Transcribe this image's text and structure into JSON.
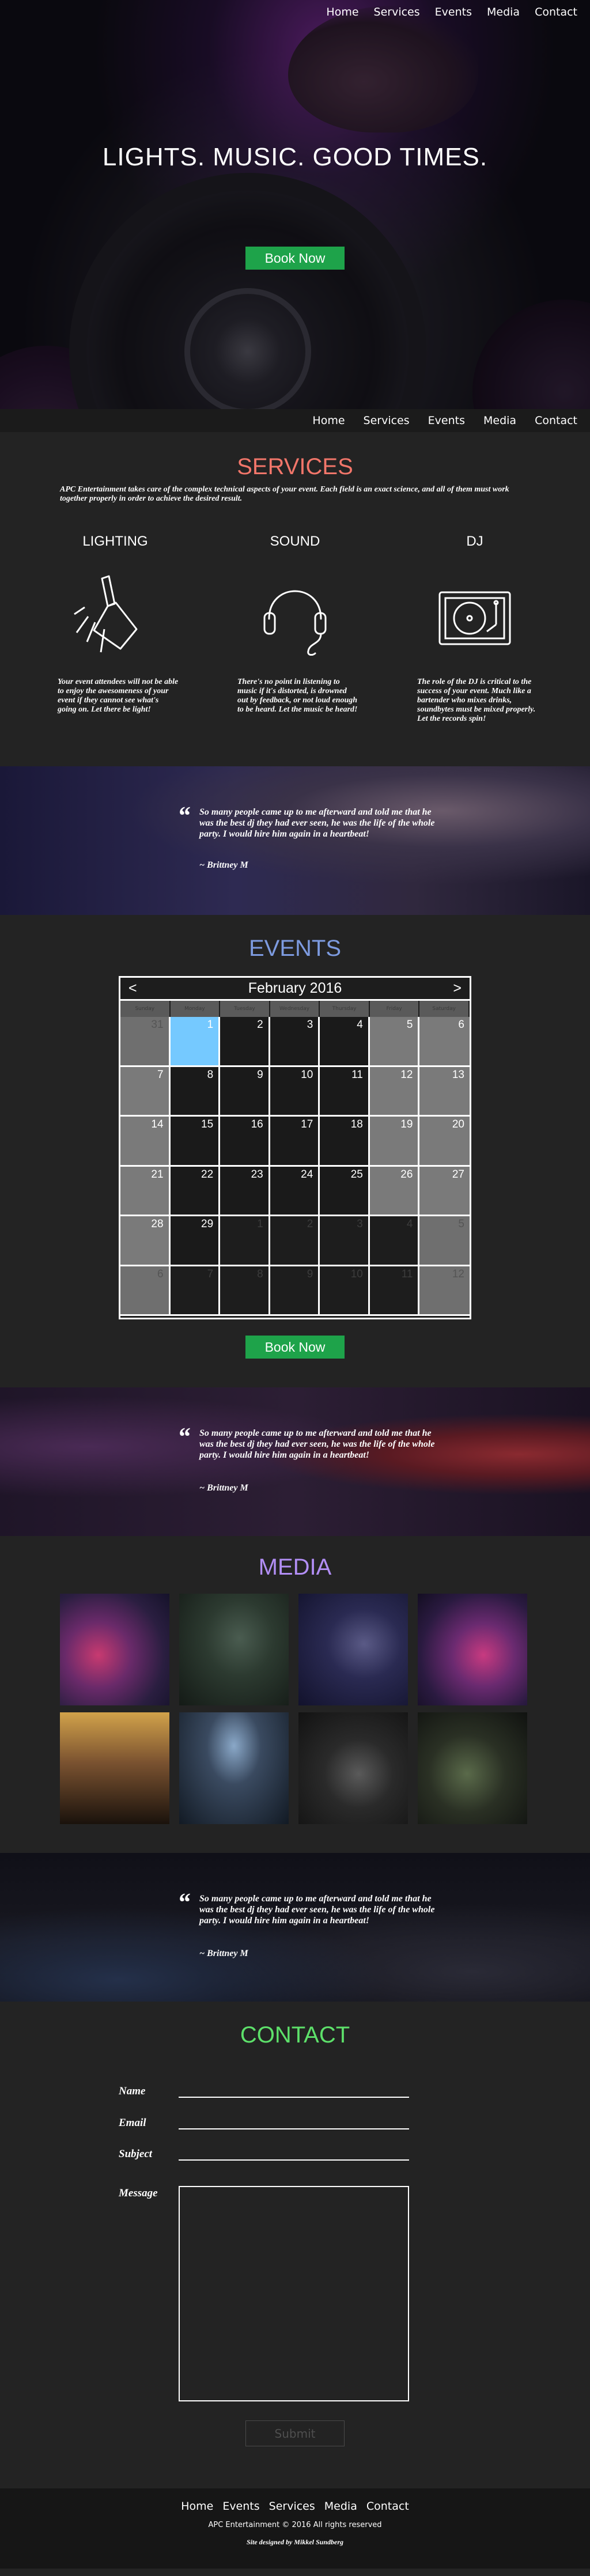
{
  "nav": {
    "items": [
      "Home",
      "Services",
      "Events",
      "Media",
      "Contact"
    ]
  },
  "hero": {
    "headline": "LIGHTS. MUSIC. GOOD TIMES.",
    "cta": "Book Now"
  },
  "services": {
    "title": "SERVICES",
    "intro": "APC Entertainment takes care of the complex technical aspects of your event.  Each field is an exact science, and all of them must work together properly in order to achieve the desired result.",
    "items": [
      {
        "title": "LIGHTING",
        "icon": "spotlight-icon",
        "text": "Your event attendees will not be able to enjoy the awesomeness of your event if they cannot see what's going on.   Let there be light!"
      },
      {
        "title": "SOUND",
        "icon": "headphones-icon",
        "text": "There's no point in listening to music if it's distorted, is drowned out by feedback, or not loud enough to be heard.  Let the music be heard!"
      },
      {
        "title": "DJ",
        "icon": "turntable-icon",
        "text": "The role of the DJ is critical to the success of your event.  Much like a bartender who mixes drinks, soundbytes must be mixed properly.  Let the records spin!"
      }
    ],
    "title_color": "#f2766a"
  },
  "testimonial": {
    "text": "So many people came up to me afterward and told me that he was the best dj they had ever seen, he was the life of the whole party.  I would hire him again in a heartbeat!",
    "author": "~ Brittney M"
  },
  "events": {
    "title": "EVENTS",
    "title_color": "#7d9be0",
    "month": "February 2016",
    "prev": "<",
    "next": ">",
    "weekdays": [
      "Sunday",
      "Monday",
      "Tuesday",
      "Wednesday",
      "Thursday",
      "Friday",
      "Saturday"
    ],
    "cells": [
      "31",
      "1",
      "2",
      "3",
      "4",
      "5",
      "6",
      "7",
      "8",
      "9",
      "10",
      "11",
      "12",
      "13",
      "14",
      "15",
      "16",
      "17",
      "18",
      "19",
      "20",
      "21",
      "22",
      "23",
      "24",
      "25",
      "26",
      "27",
      "28",
      "29",
      "1",
      "2",
      "3",
      "4",
      "5",
      "6",
      "7",
      "8",
      "9",
      "10",
      "11",
      "12"
    ],
    "selected_day": "1",
    "selected_color": "#75c9ff",
    "cta": "Book Now"
  },
  "media": {
    "title": "MEDIA",
    "title_color": "#b28ef5",
    "photos": [
      "dj-decks-photo",
      "dj-booth-photo",
      "mixer-photo",
      "turntable-photo",
      "crowd-hands-photo",
      "concert-stage-photo",
      "cdj-photo",
      "party-crowd-photo"
    ]
  },
  "contact": {
    "title": "CONTACT",
    "title_color": "#5de06a",
    "fields": [
      "Name",
      "Email",
      "Subject"
    ],
    "message_label": "Message",
    "submit": "Submit"
  },
  "footer": {
    "copyright": "APC Entertainment © 2016 All rights reserved",
    "credit": "Site designed by Mikkel Sundberg"
  }
}
